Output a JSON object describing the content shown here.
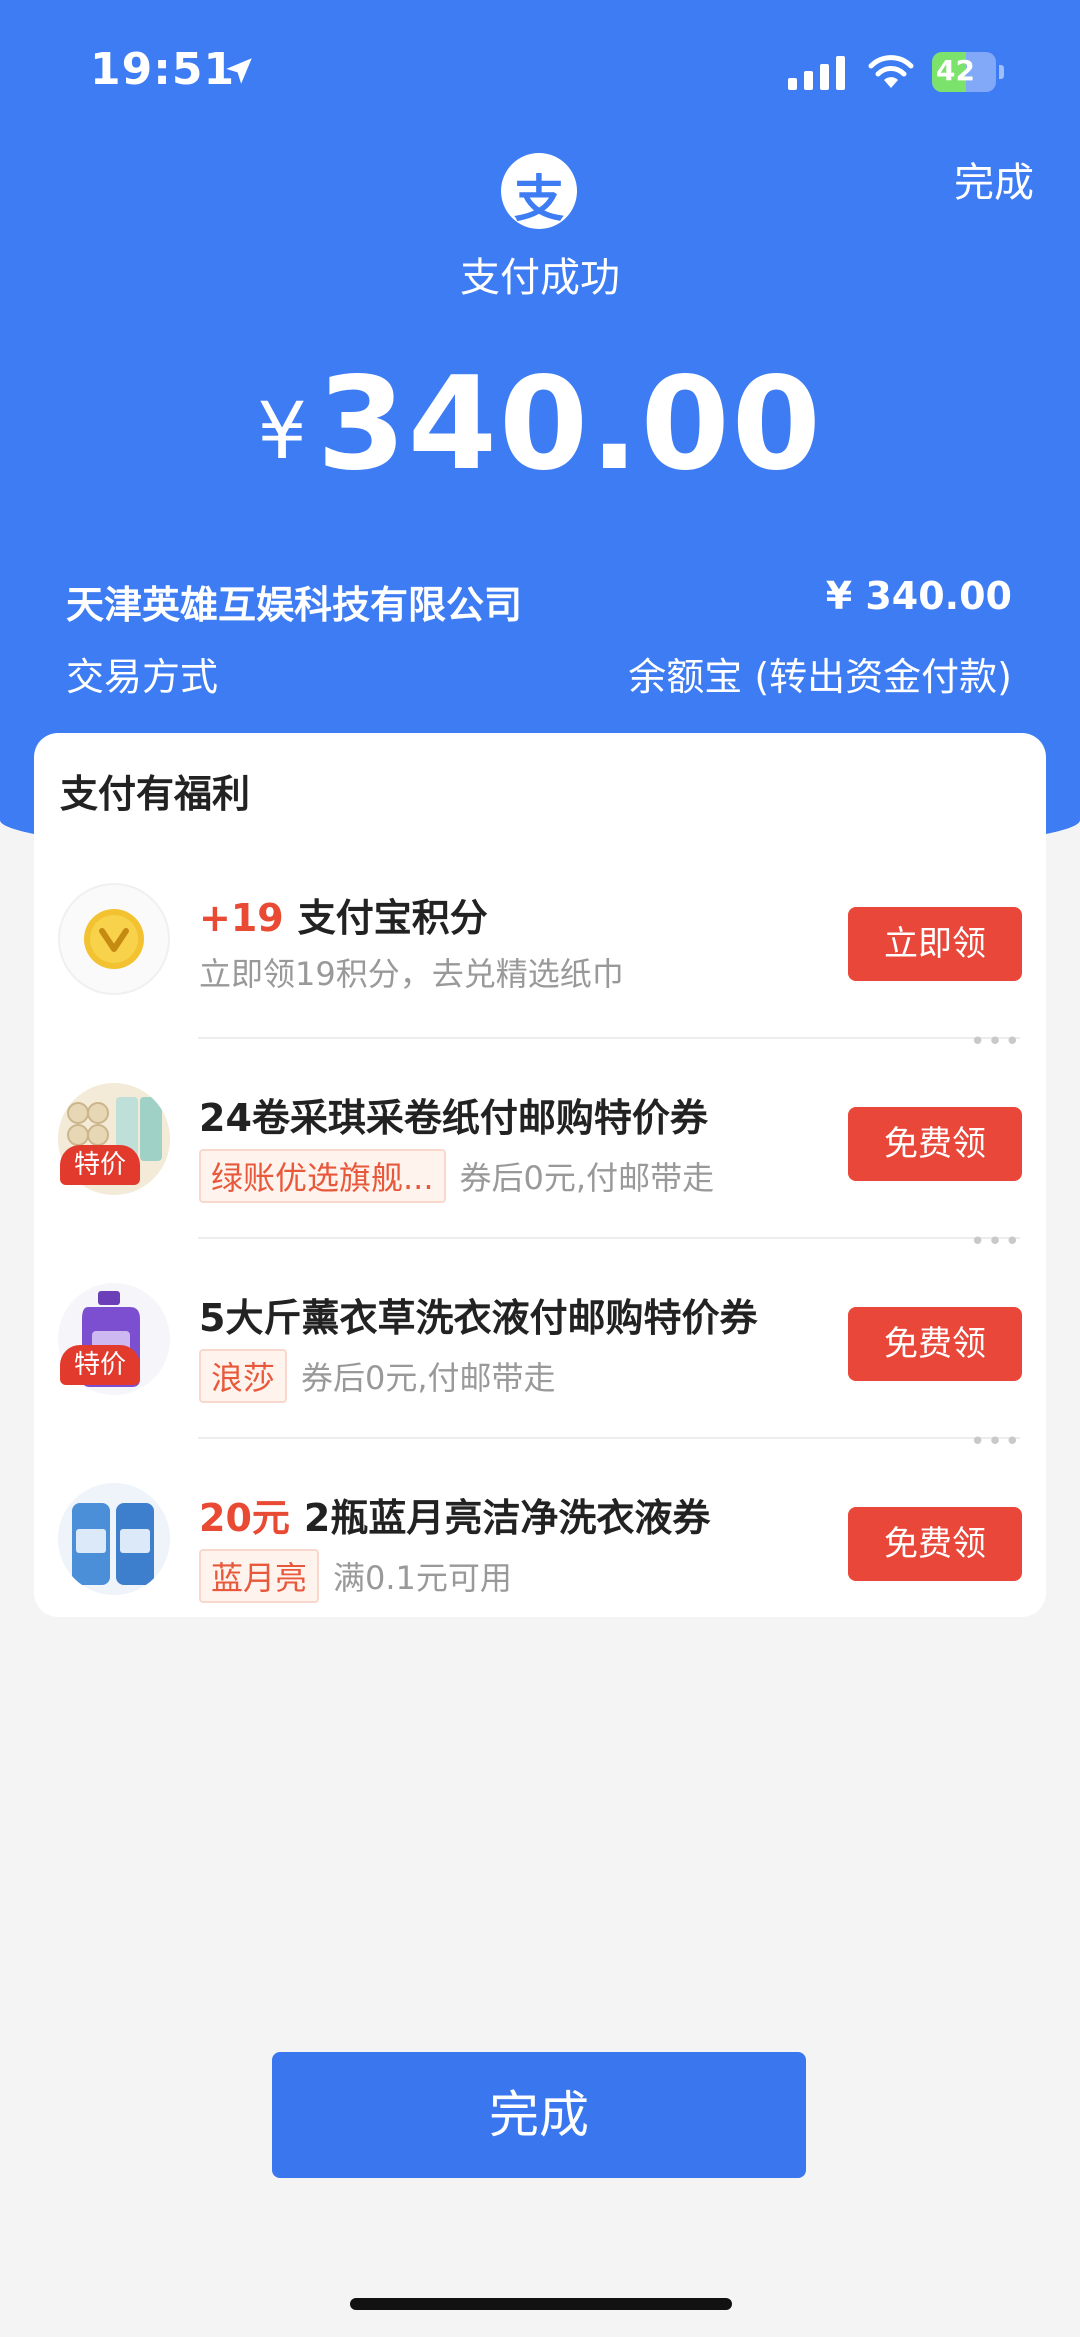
{
  "status_bar": {
    "time": "19:51",
    "battery": "42"
  },
  "header": {
    "done_label": "完成",
    "logo_char": "支",
    "title": "支付成功",
    "currency": "¥",
    "amount": "340.00"
  },
  "details": {
    "merchant": "天津英雄互娱科技有限公司",
    "merchant_amount": "¥ 340.00",
    "method_label": "交易方式",
    "method_value": "余额宝 (转出资金付款)"
  },
  "benefits": {
    "title": "支付有福利",
    "items": [
      {
        "highlight": "+19",
        "title": "支付宝积分",
        "subtitle": "立即领19积分，去兑精选纸巾",
        "button": "立即领"
      },
      {
        "title": "24卷采琪采卷纸付邮购特价券",
        "tag": "绿账优选旗舰...",
        "subtitle": "券后0元,付邮带走",
        "badge": "特价",
        "button": "免费领"
      },
      {
        "title": "5大斤薰衣草洗衣液付邮购特价券",
        "tag": "浪莎",
        "subtitle": "券后0元,付邮带走",
        "badge": "特价",
        "button": "免费领"
      },
      {
        "highlight": "20元",
        "title": "2瓶蓝月亮洁净洗衣液券",
        "tag": "蓝月亮",
        "subtitle": "满0.1元可用",
        "button": "免费领"
      }
    ]
  },
  "footer": {
    "done_button": "完成"
  },
  "colors": {
    "primary_blue": "#3e7cf4",
    "accent_red": "#e8473a"
  }
}
